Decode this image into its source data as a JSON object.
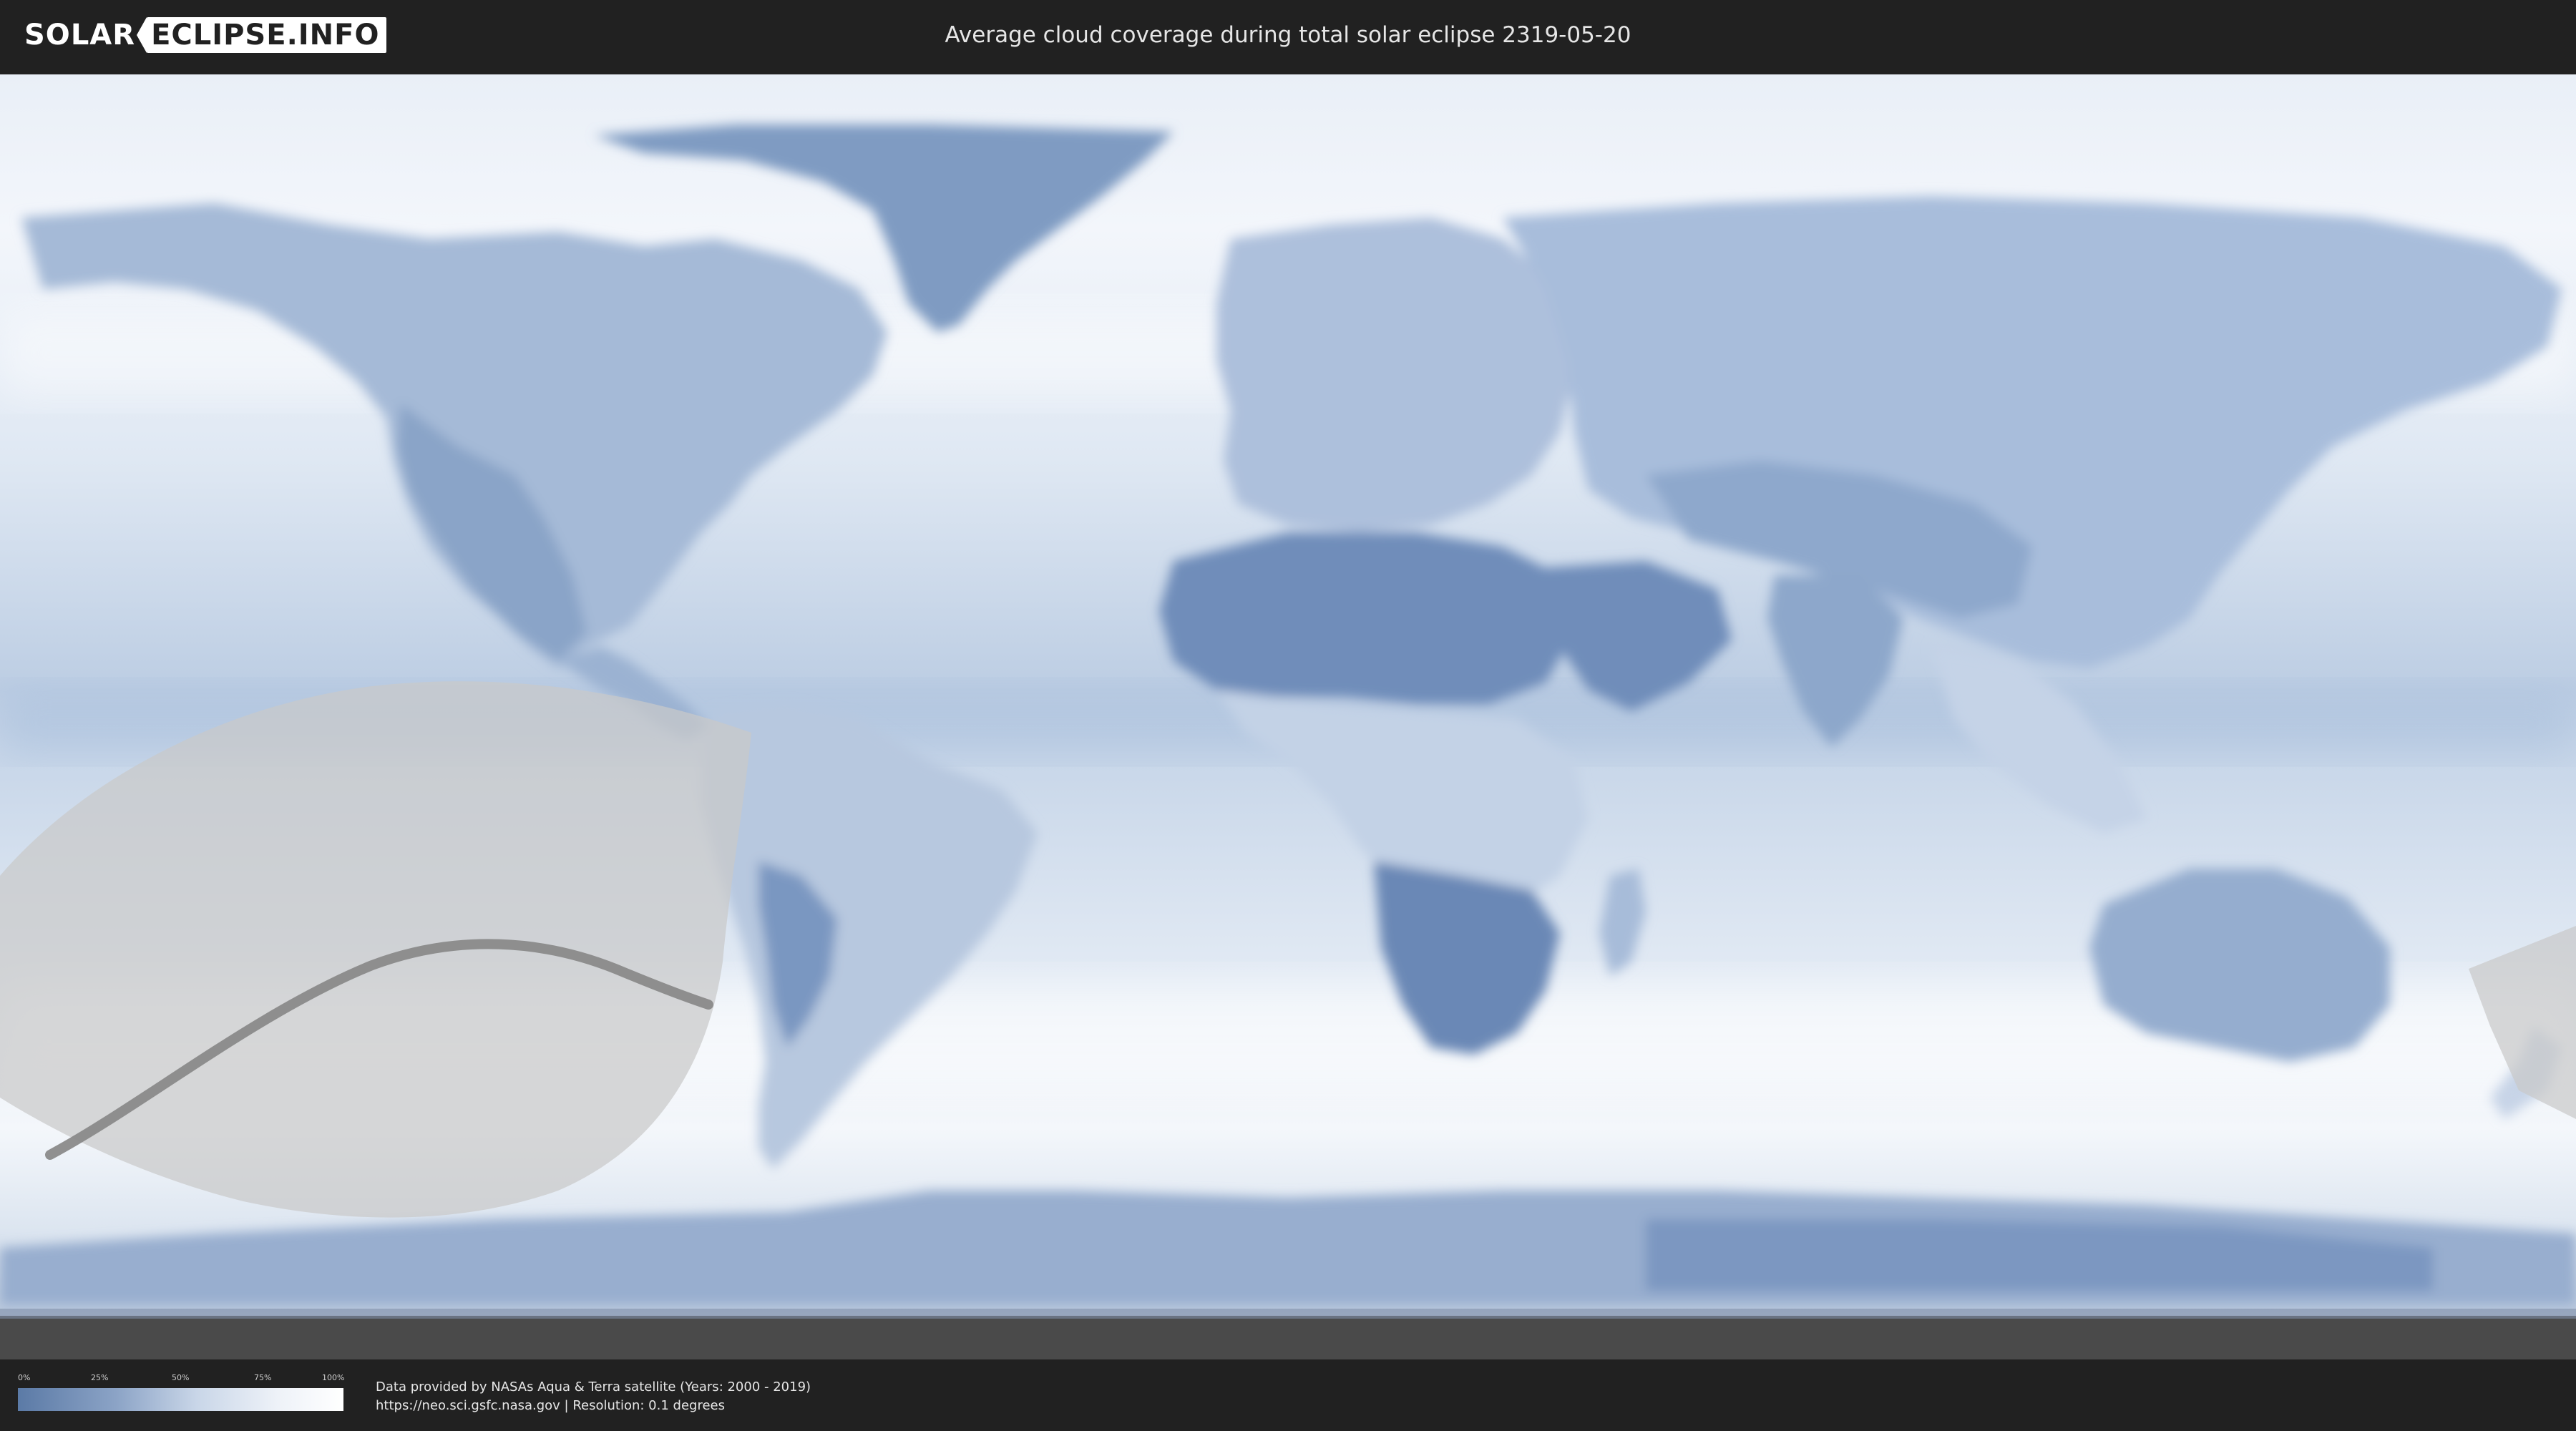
{
  "header": {
    "logo_left": "SOLAR",
    "logo_right": "ECLIPSE.INFO",
    "title": "Average cloud coverage during total solar eclipse 2319-05-20"
  },
  "legend": {
    "ticks": [
      "0%",
      "25%",
      "50%",
      "75%",
      "100%"
    ],
    "colors": {
      "low": "#5b7aa6",
      "mid": "#c9d6e8",
      "high": "#ffffff"
    }
  },
  "footer": {
    "credit_line1": "Data provided by NASAs Aqua & Terra satellite (Years: 2000 - 2019)",
    "credit_line2": "https://neo.sci.gsfc.nasa.gov | Resolution: 0.1 degrees"
  },
  "colors": {
    "background": "#212121",
    "ocean_cloud": "#eef3f9",
    "land_clear": "#7f9cc2",
    "eclipse_area": "#d0d0d0",
    "eclipse_path": "#8a8a8a"
  }
}
